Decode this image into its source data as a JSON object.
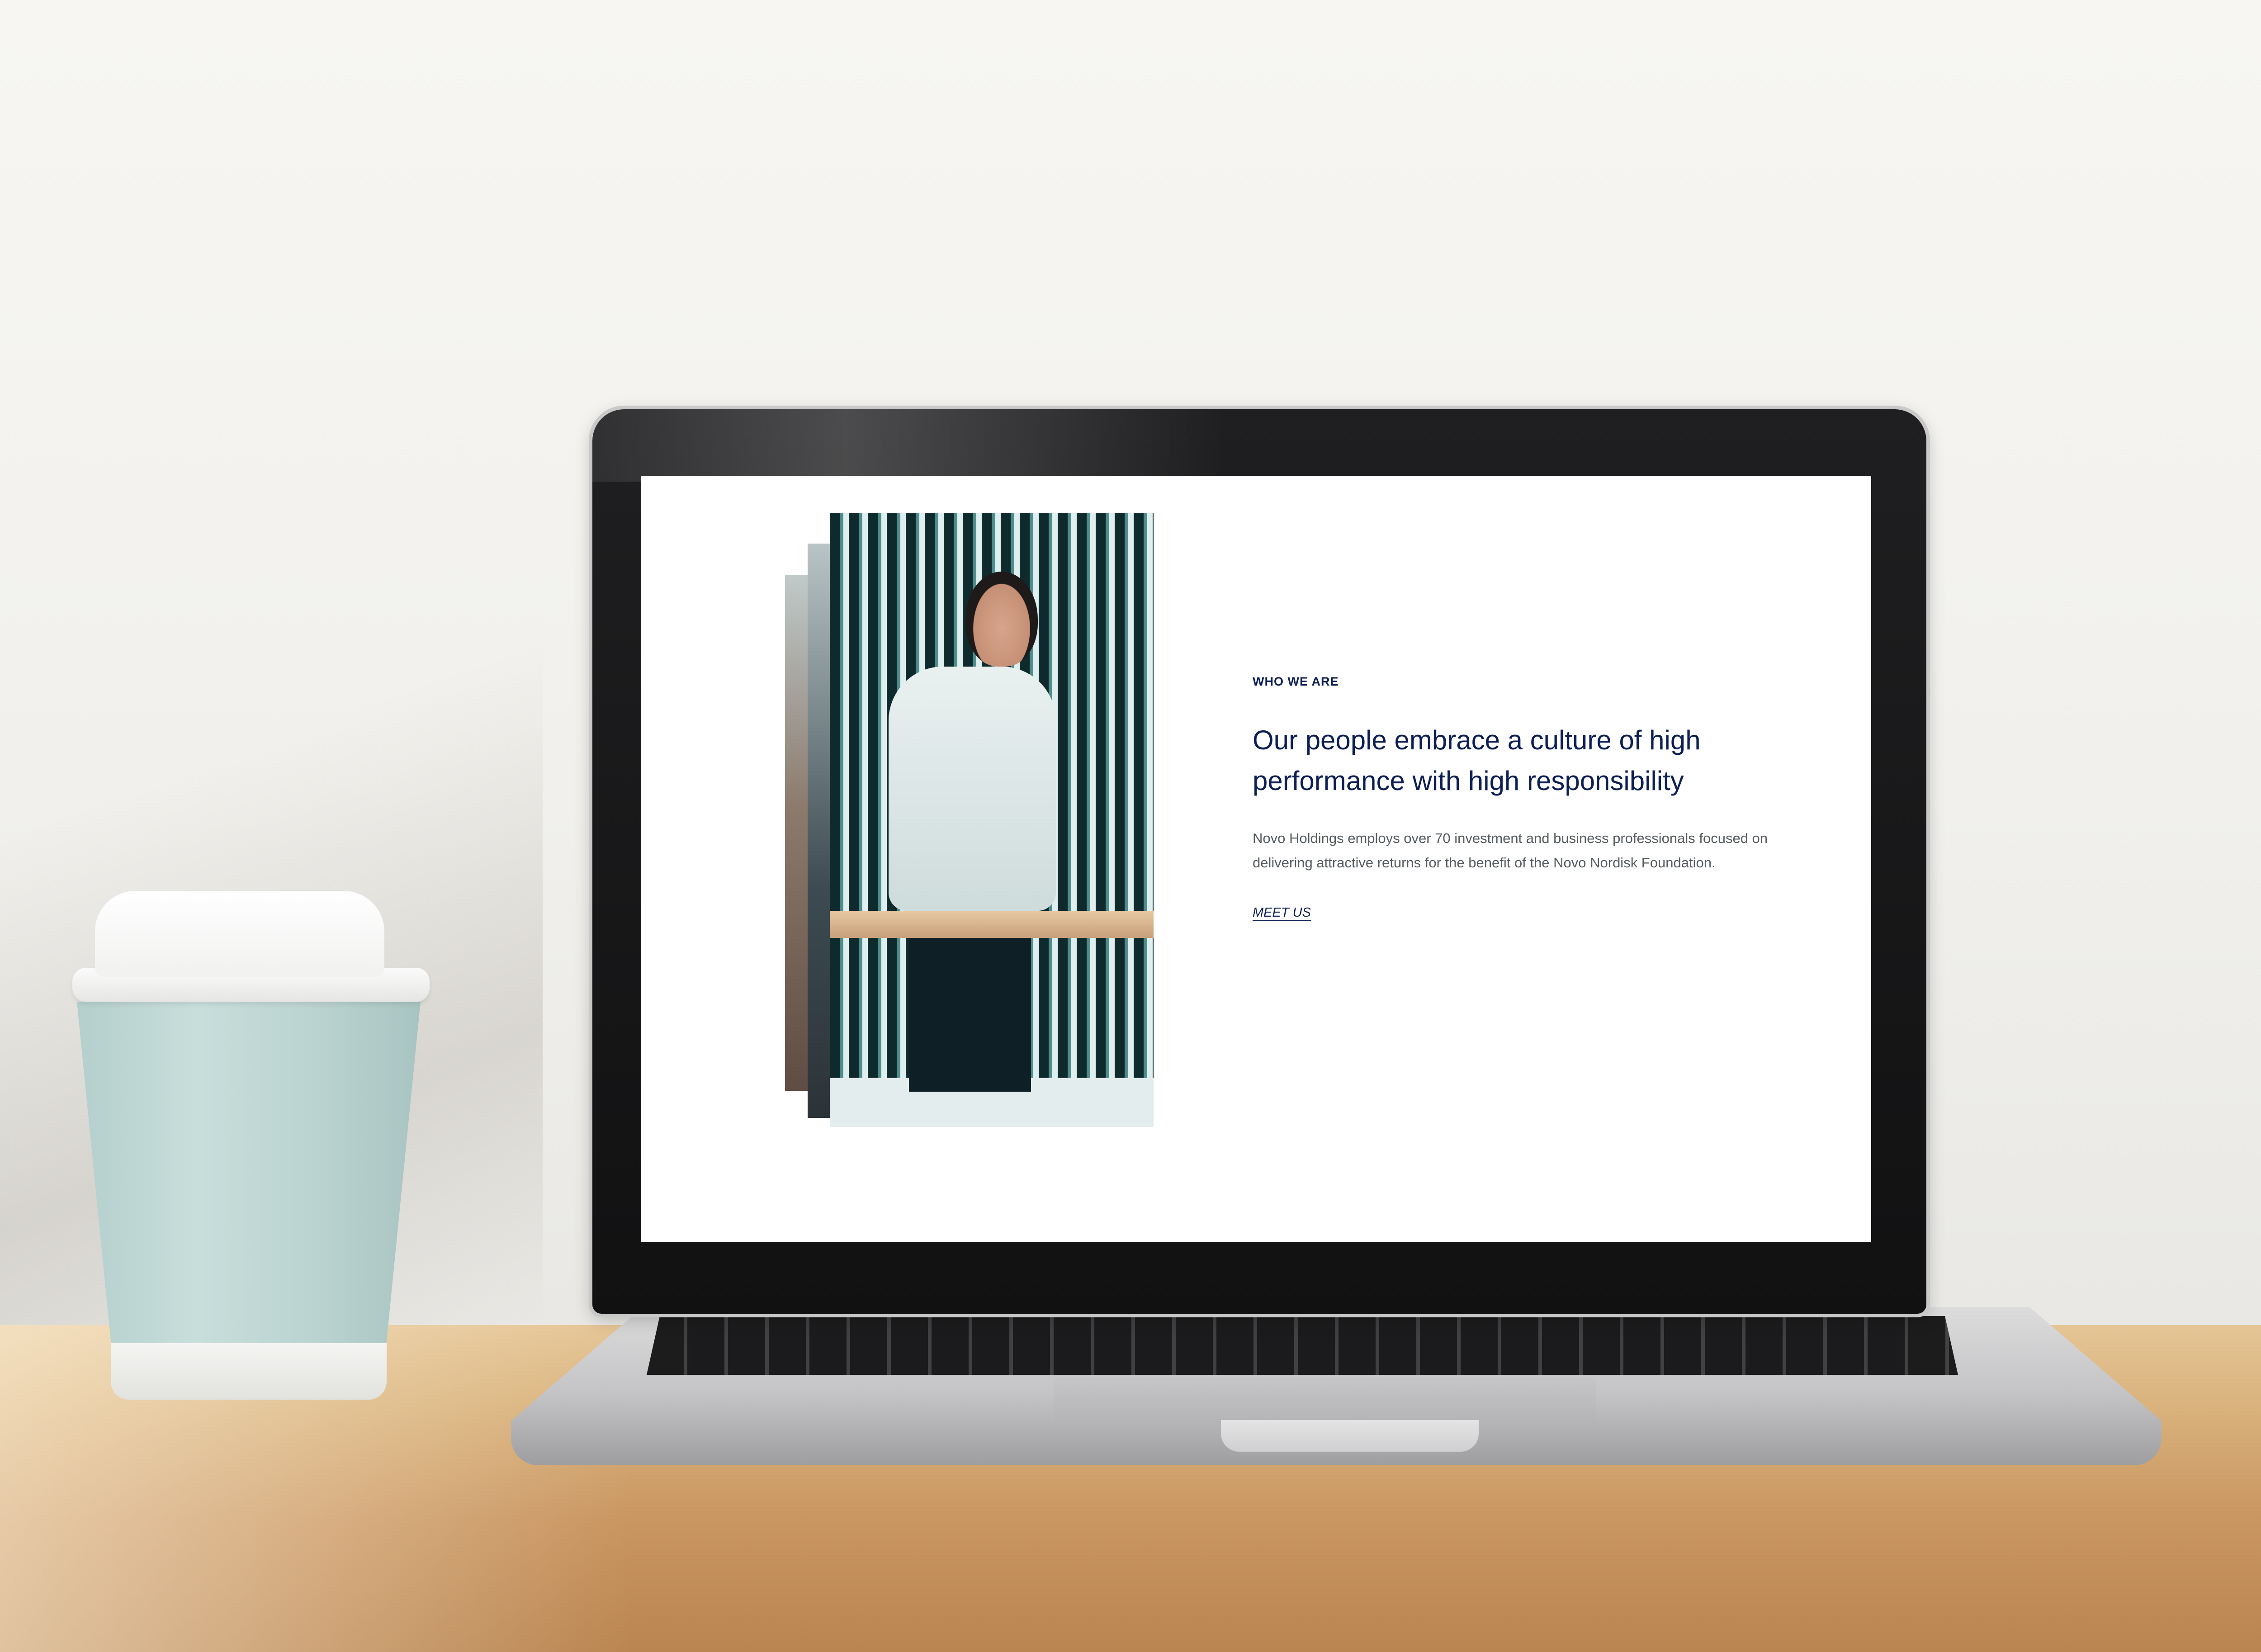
{
  "section": {
    "eyebrow": "WHO WE ARE",
    "headline": "Our people embrace a culture of high performance with high responsibility",
    "body": "Novo Holdings employs over 70 investment and business professionals focused on delivering attractive returns for the benefit of the Novo Nordisk Foundation.",
    "cta_label": "MEET US"
  },
  "colors": {
    "heading": "#0c1f55",
    "body_text": "#555a63",
    "background": "#ffffff"
  }
}
